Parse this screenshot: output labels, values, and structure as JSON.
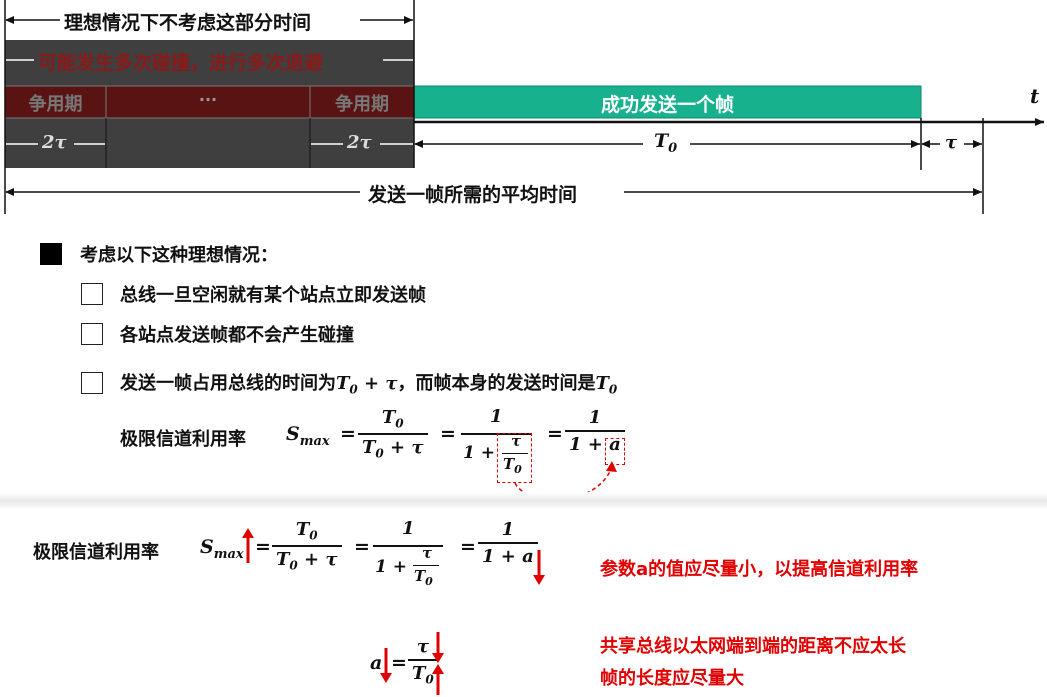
{
  "timeline": {
    "ideal_label": "理想情况下不考虑这部分时间",
    "collision_label": "可能发生多次碰撞，进行多次退避",
    "contention_left": "争用期",
    "ellipsis": "···",
    "contention_right": "争用期",
    "success_frame": "成功发送一个帧",
    "t_axis": "t",
    "two_tau_left": "2τ",
    "two_tau_right": "2τ",
    "t0": "T",
    "t0_sub": "0",
    "tau": "τ",
    "avg_time": "发送一帧所需的平均时间"
  },
  "conditions": {
    "heading": "考虑以下这种理想情况：",
    "items": [
      "总线一旦空闲就有某个站点立即发送帧",
      "各站点发送帧都不会产生碰撞"
    ],
    "item3_prefix": "发送一帧占用总线的时间为",
    "item3_mid": "，而帧本身的发送时间是",
    "formula_label": "极限信道利用率"
  },
  "formula": {
    "s": "S",
    "s_sub": "max",
    "eq": "=",
    "t0": "T",
    "sub0": "0",
    "plus_tau": " + τ",
    "one": "1",
    "one_plus": "1 +",
    "tau": "τ",
    "one_plus_a": "1 + a",
    "a": "a"
  },
  "bottom": {
    "formula_label": "极限信道利用率",
    "note1": "参数a的值应尽量小，以提高信道利用率",
    "note2_line1": "共享总线以太网端到端的距离不应太长",
    "note2_line2": "帧的长度应尽量大"
  },
  "colors": {
    "contention_fill": "#3f3f3f",
    "contention_cell": "#5a1313",
    "success_fill": "#17b28d",
    "accent_red": "#e00000"
  }
}
